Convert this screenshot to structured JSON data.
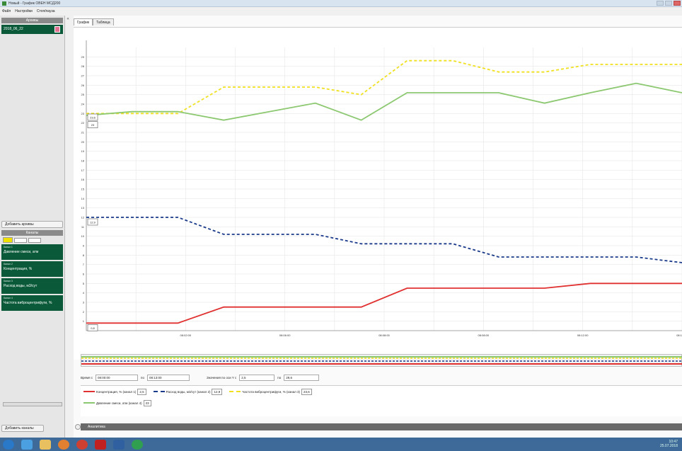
{
  "window": {
    "title": "Новый - График ОВЕН МСД200"
  },
  "menu": [
    "Файл",
    "Настройки",
    "Стоп/пауза"
  ],
  "sidebar": {
    "archives_title": "Архивы",
    "archive_item": "2018_06_22",
    "add_archive": "Добавить архивы",
    "panels_title": "Каналы",
    "channels": [
      {
        "tag": "Канал 1",
        "name": "Давление смеси, атм"
      },
      {
        "tag": "Канал 2",
        "name": "Концентрация, %"
      },
      {
        "tag": "Канал 3",
        "name": "Расход воды, м3/сут"
      },
      {
        "tag": "Канал 4",
        "name": "Частота виброцентрифуги, %"
      }
    ],
    "add_panel": "Добавить каналы"
  },
  "tabs": [
    "График",
    "Таблица"
  ],
  "chart_data": {
    "type": "line",
    "y_ticks": [
      "1",
      "2",
      "3",
      "4",
      "5",
      "6",
      "7",
      "8",
      "9",
      "10",
      "11",
      "12",
      "13",
      "14",
      "15",
      "16",
      "17",
      "18",
      "19",
      "20",
      "21",
      "22",
      "23",
      "24",
      "25",
      "26",
      "27",
      "28",
      "29"
    ],
    "x_ticks": [
      "08:02:00",
      "08:06:00",
      "08:08:00",
      "08:08:00",
      "08:12:00",
      "08:12:00"
    ],
    "x": [
      0,
      1,
      2,
      3,
      4,
      5,
      6,
      7,
      8,
      9,
      10,
      11,
      12,
      13
    ],
    "ylim": [
      0,
      30
    ],
    "series": [
      {
        "name": "Концентрация, % (канал 1)",
        "color": "#e03030",
        "style": "solid",
        "values": [
          0.8,
          0.8,
          0.8,
          2.5,
          2.5,
          2.5,
          2.5,
          4.5,
          4.5,
          4.5,
          4.5,
          5.0,
          5.0,
          5.0
        ]
      },
      {
        "name": "Расход воды, м3/сут (канал 2)",
        "color": "#1a3a8a",
        "style": "dashed",
        "values": [
          12.0,
          12.0,
          12.0,
          10.2,
          10.2,
          10.2,
          9.2,
          9.2,
          9.2,
          7.8,
          7.8,
          7.8,
          7.8,
          7.2
        ]
      },
      {
        "name": "Частота виброцентрифуги, % (канал 3)",
        "color": "#f0e020",
        "style": "dashed",
        "values": [
          23.0,
          23.0,
          23.0,
          25.8,
          25.8,
          25.8,
          25.0,
          28.6,
          28.6,
          27.4,
          27.4,
          28.2,
          28.2,
          28.2
        ]
      },
      {
        "name": "Давление смеси, атм (канал 4)",
        "color": "#8cc870",
        "style": "solid",
        "values": [
          22.8,
          23.2,
          23.2,
          22.3,
          23.2,
          24.1,
          22.3,
          25.2,
          25.2,
          25.2,
          24.1,
          25.2,
          26.2,
          25.2
        ]
      }
    ],
    "markers": [
      {
        "label": "0,8",
        "y": 0.8
      },
      {
        "label": "12,9",
        "y": 12.0
      },
      {
        "label": "23,6",
        "y": 23.1
      },
      {
        "label": "23",
        "y": 22.3
      }
    ]
  },
  "range": {
    "time_label": "Время с",
    "time_from": "08:00:00",
    "time_to_label": "по",
    "time_to": "08:13:00",
    "value_label": "Значения по оси Y с",
    "value_from": "2,5",
    "value_to_label": "по",
    "value_to": "29,6"
  },
  "legend": [
    {
      "label": "Концентрация, % (канал 1)",
      "value": "2,5",
      "color": "#e03030",
      "dash": false
    },
    {
      "label": "Расход воды, м3/сут (канал 2)",
      "value": "12,9",
      "color": "#1a3a8a",
      "dash": true
    },
    {
      "label": "Частота виброцентрифуги, % (канал 3)",
      "value": "23,6",
      "color": "#f0e020",
      "dash": true
    },
    {
      "label": "Давление смеси, атм (канал 4)",
      "value": "23",
      "color": "#8cc870",
      "dash": false
    }
  ],
  "bottom_panel": "Аналитика",
  "tray": {
    "time": "10:47",
    "date": "25.07.2018"
  }
}
